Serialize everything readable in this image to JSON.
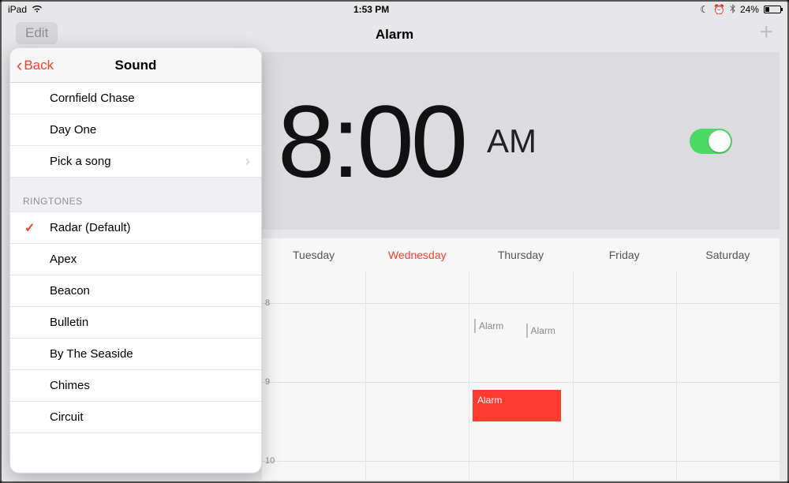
{
  "status": {
    "device": "iPad",
    "time": "1:53 PM",
    "battery_pct": "24%"
  },
  "nav": {
    "edit": "Edit",
    "title": "Alarm",
    "add": "+"
  },
  "alarm": {
    "hour": "8",
    "colon": ":",
    "minutes": "00",
    "ampm": "AM",
    "enabled": true
  },
  "schedule": {
    "days": [
      "Tuesday",
      "Wednesday",
      "Thursday",
      "Friday",
      "Saturday"
    ],
    "today_index": 1,
    "hour_labels": [
      "8",
      "9",
      "10"
    ],
    "events": {
      "e1": "Alarm",
      "e2": "Alarm",
      "e3": "Alarm"
    }
  },
  "popover": {
    "back": "Back",
    "title": "Sound",
    "songs": [
      "Cornfield Chase",
      "Day One",
      "Pick a song"
    ],
    "section_label": "RINGTONES",
    "ringtones": [
      "Radar (Default)",
      "Apex",
      "Beacon",
      "Bulletin",
      "By The Seaside",
      "Chimes",
      "Circuit"
    ],
    "selected_ringtone_index": 0
  }
}
